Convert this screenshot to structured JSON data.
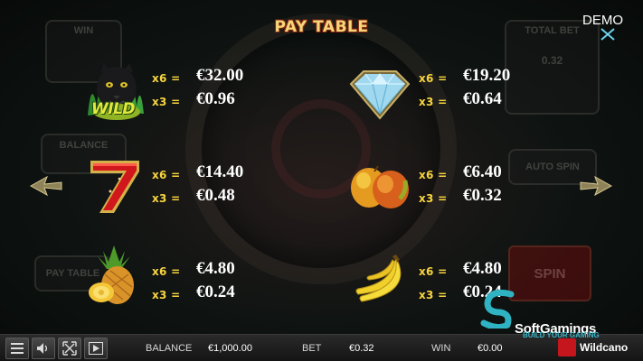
{
  "header": {
    "title": "PAY TABLE",
    "demo_label": "DEMO"
  },
  "background": {
    "win_label": "WIN",
    "balance_label": "BALANCE",
    "total_bet_label": "TOTAL BET",
    "total_bet_value": "0.32",
    "auto_spin_label": "AUTO SPIN",
    "pay_table_label": "PAY TABLE",
    "spin_label": "SPIN"
  },
  "paytable": [
    {
      "symbol": "panther-wild",
      "wild_text": "WILD",
      "rows": [
        {
          "mult": "x6 =",
          "amount": "€32.00"
        },
        {
          "mult": "x3 =",
          "amount": "€0.96"
        }
      ]
    },
    {
      "symbol": "diamond",
      "rows": [
        {
          "mult": "x6 =",
          "amount": "€19.20"
        },
        {
          "mult": "x3 =",
          "amount": "€0.64"
        }
      ]
    },
    {
      "symbol": "seven",
      "rows": [
        {
          "mult": "x6 =",
          "amount": "€14.40"
        },
        {
          "mult": "x3 =",
          "amount": "€0.48"
        }
      ]
    },
    {
      "symbol": "mango",
      "rows": [
        {
          "mult": "x6 =",
          "amount": "€6.40"
        },
        {
          "mult": "x3 =",
          "amount": "€0.32"
        }
      ]
    },
    {
      "symbol": "pineapple",
      "rows": [
        {
          "mult": "x6 =",
          "amount": "€4.80"
        },
        {
          "mult": "x3 =",
          "amount": "€0.24"
        }
      ]
    },
    {
      "symbol": "banana",
      "rows": [
        {
          "mult": "x6 =",
          "amount": "€4.80"
        },
        {
          "mult": "x3 =",
          "amount": "€0.24"
        }
      ]
    }
  ],
  "branding": {
    "softgamings": "SoftGamings",
    "softgamings_tagline": "BUILD YOUR GAMING",
    "provider": "Wildcano"
  },
  "bottom_bar": {
    "balance_label": "BALANCE",
    "balance_value": "€1,000.00",
    "bet_label": "BET",
    "bet_value": "€0.32",
    "win_label": "WIN",
    "win_value": "€0.00"
  },
  "colors": {
    "title_gold": "#f5d77a",
    "multiplier_yellow": "#f7d43f",
    "amount_white": "#ffffff",
    "seven_red": "#d0181c",
    "brand_teal": "#39b6c7"
  }
}
